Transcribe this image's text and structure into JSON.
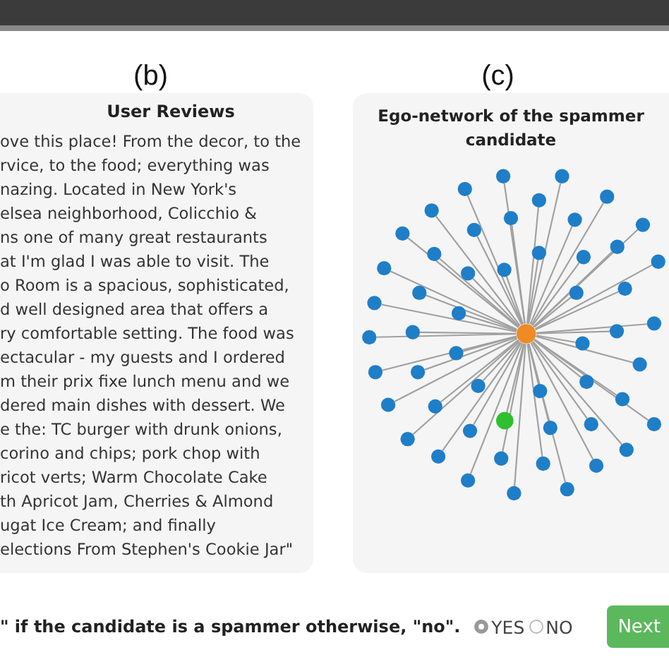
{
  "panel_labels": [
    "(b)",
    "(c)"
  ],
  "reviews": {
    "title": "User Reviews",
    "lines": [
      "ove this place! From the decor, to the",
      "rvice, to the food; everything was",
      "nazing. Located in New York's",
      "elsea neighborhood, Colicchio &",
      "ns one of many great restaurants",
      "at I'm glad I was able to visit. The",
      "o Room is a spacious, sophisticated,",
      "d well designed area that offers a",
      "ry comfortable setting. The food was",
      "ectacular - my guests and I ordered",
      "m their prix fixe lunch menu and we",
      "dered main dishes with dessert. We",
      "e the: TC burger with drunk onions,",
      "corino and chips; pork chop with",
      "ricot verts; Warm Chocolate Cake",
      "th Apricot Jam, Cherries & Almond",
      "ugat Ice Cream; and finally",
      "elections From Stephen's Cookie Jar\""
    ]
  },
  "network": {
    "title": "Ego-network of the spammer candidate"
  },
  "question": "\" if the candidate is a spammer otherwise, \"no\".",
  "options": [
    {
      "label": "YES",
      "selected": true
    },
    {
      "label": "NO",
      "selected": false
    }
  ],
  "next_button": "Next"
}
